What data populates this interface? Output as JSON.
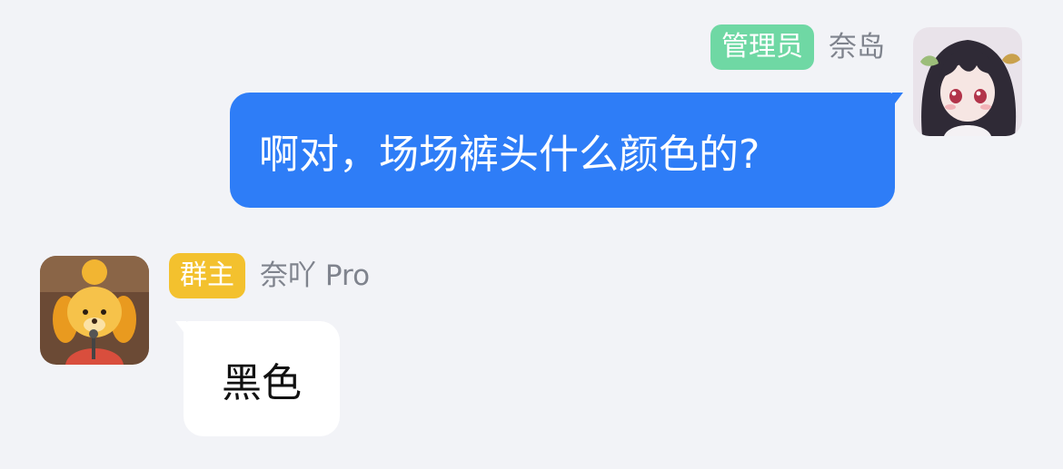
{
  "colors": {
    "background": "#f2f3f7",
    "outgoing_bubble": "#2e7df7",
    "outgoing_text": "#ffffff",
    "incoming_bubble": "#ffffff",
    "incoming_text": "#111111",
    "admin_badge": "#6fd8a4",
    "owner_badge": "#f3c12e",
    "name_text": "#7f838d"
  },
  "messages": [
    {
      "role_badge": "管理员",
      "sender": "奈岛",
      "text": "啊对，场场裤头什么颜色的?",
      "avatar_icon": "anime-girl-avatar-icon"
    },
    {
      "role_badge": "群主",
      "sender": "奈吖 Pro",
      "text": "黑色",
      "avatar_icon": "yellow-dog-avatar-icon"
    }
  ]
}
